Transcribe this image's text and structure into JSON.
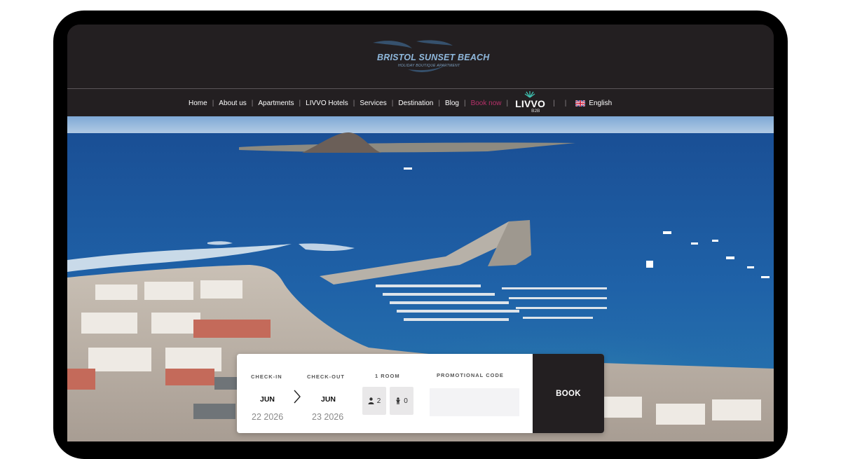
{
  "header": {
    "logo_title": "BRISTOL SUNSET BEACH",
    "logo_subtitle": "HOLIDAY BOUTIQUE APARTMENT"
  },
  "nav": {
    "items": [
      "Home",
      "About us",
      "Apartments",
      "LIVVO Hotels",
      "Services",
      "Destination",
      "Blog",
      "Book now"
    ],
    "separator": "|",
    "livvo_logo": "LIVVO",
    "livvo_sub": "B2B",
    "language": "English"
  },
  "booking": {
    "checkin_label": "CHECK-IN",
    "checkin_month": "JUN",
    "checkin_date": "22 2026",
    "checkout_label": "CHECK-OUT",
    "checkout_month": "JUN",
    "checkout_date": "23 2026",
    "room_label": "1 ROOM",
    "adults": "2",
    "children": "0",
    "promo_label": "PROMOTIONAL CODE",
    "promo_value": "",
    "book_label": "BOOK"
  },
  "colors": {
    "header_bg": "#231f21",
    "book_now": "#b8306a",
    "logo_blue": "#8fb8dc",
    "sea": "#1f5fa3"
  },
  "icons": [
    "chevron-right-icon",
    "adult-icon",
    "child-icon",
    "uk-flag-icon",
    "livvo-leaf-icon"
  ]
}
